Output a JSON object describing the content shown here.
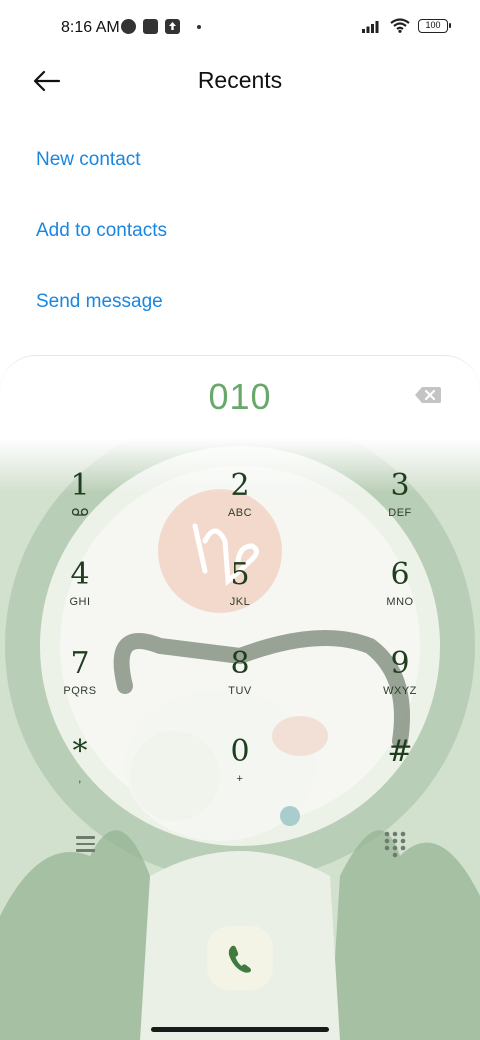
{
  "status_bar": {
    "time": "8:16 AM",
    "battery": "100",
    "icons": [
      "data-saver-icon",
      "notification-icon",
      "upload-icon",
      "dot-icon",
      "signal-icon",
      "wifi-icon",
      "battery-icon"
    ]
  },
  "header": {
    "title": "Recents",
    "back_icon": "back-arrow-icon"
  },
  "actions": {
    "new_contact": "New contact",
    "add_to_contacts": "Add to contacts",
    "send_message": "Send message"
  },
  "dialer": {
    "number": "010",
    "keys": [
      {
        "digit": "1",
        "letters": ""
      },
      {
        "digit": "2",
        "letters": "ABC"
      },
      {
        "digit": "3",
        "letters": "DEF"
      },
      {
        "digit": "4",
        "letters": "GHI"
      },
      {
        "digit": "5",
        "letters": "JKL"
      },
      {
        "digit": "6",
        "letters": "MNO"
      },
      {
        "digit": "7",
        "letters": "PQRS"
      },
      {
        "digit": "8",
        "letters": "TUV"
      },
      {
        "digit": "9",
        "letters": "WXYZ"
      },
      {
        "digit": "*",
        "letters": ","
      },
      {
        "digit": "0",
        "letters": "+"
      },
      {
        "digit": "#",
        "letters": ""
      }
    ],
    "key1_sub_icon": "voicemail-icon",
    "accent_color": "#69a86c",
    "call_icon": "phone-icon"
  },
  "colors": {
    "link": "#1a86e0",
    "digit": "#1f3d1f"
  }
}
